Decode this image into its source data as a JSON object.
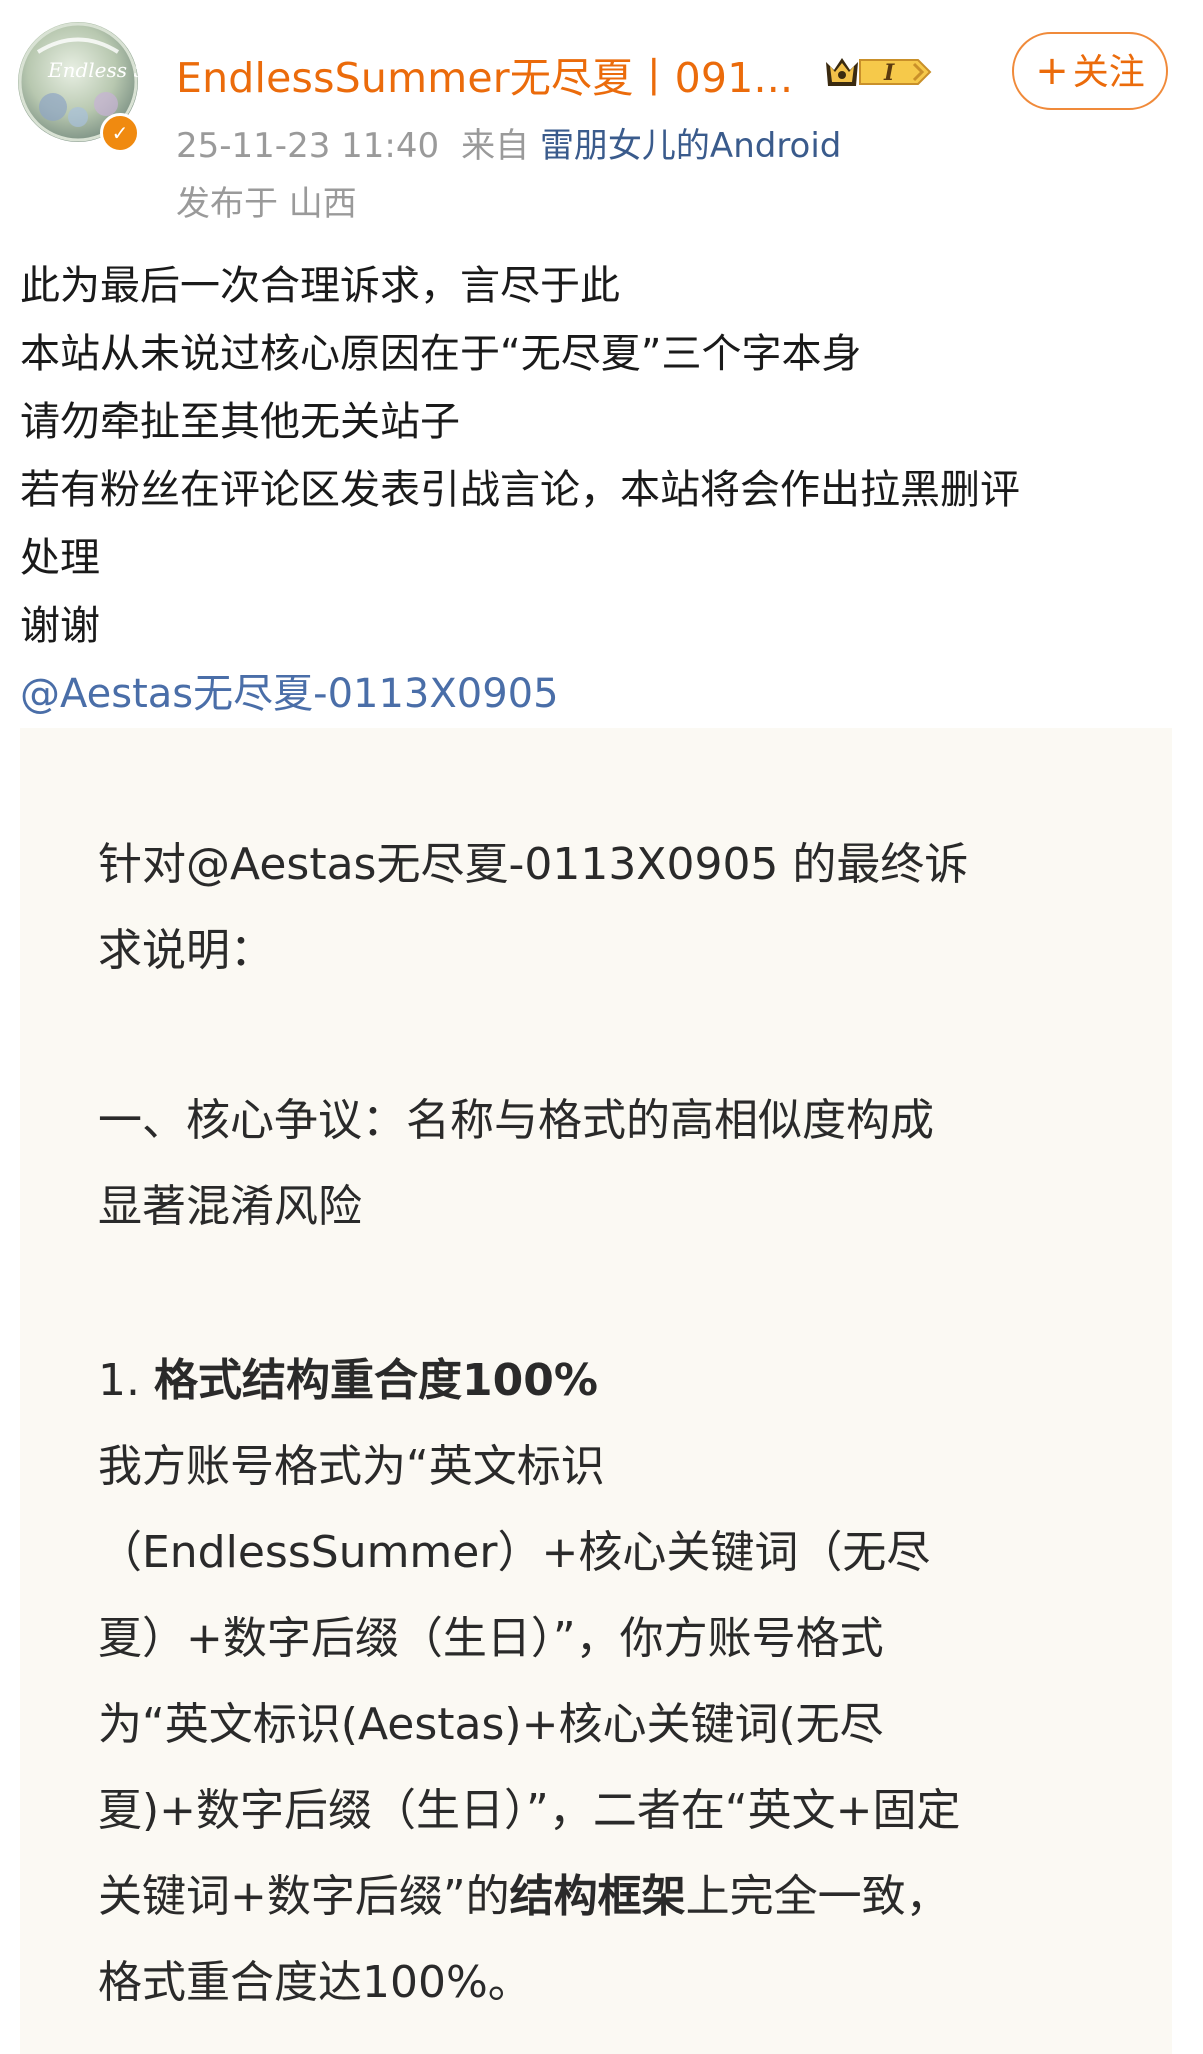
{
  "header": {
    "username": "EndlessSummer无尽夏丨091...",
    "follow_label": "关注",
    "timestamp": "25-11-23 11:40",
    "source_prefix": "来自",
    "source_app": "雷朋女儿的Android",
    "location": "发布于 山西",
    "vip_level": "I",
    "avatar_text": "Endless Summer 无尽夏"
  },
  "post": {
    "lines": [
      "此为最后一次合理诉求，言尽于此",
      "本站从未说过核心原因在于“无尽夏”三个字本身",
      "请勿牵扯至其他无关站子",
      "若有粉丝在评论区发表引战言论，本站将会作出拉黑删评",
      "处理",
      "谢谢"
    ],
    "mention": "@Aestas无尽夏-0113X0905"
  },
  "image": {
    "title_line1": "针对@Aestas无尽夏-0113X0905 的最终诉",
    "title_line2": "求说明：",
    "section1_line1": "一、核心争议：名称与格式的高相似度构成",
    "section1_line2": "显著混淆风险",
    "point1_num": "1. ",
    "point1_title": "格式结构重合度100%",
    "para_line1": "我方账号格式为“英文标识",
    "para_line2": "（EndlessSummer）+核心关键词（无尽",
    "para_line3": "夏）+数字后缀（生日）”，你方账号格式",
    "para_line4": "为“英文标识(Aestas)+核心关键词(无尽",
    "para_line5": "夏)+数字后缀（生日）”，二者在“英文+固定",
    "para_line6_a": "关键词+数字后缀”的",
    "para_line6_b": "结构框架",
    "para_line6_c": "上完全一致，",
    "para_line7": "格式重合度达100%。"
  },
  "colors": {
    "username": "#eb6b0b",
    "link": "#4a6ea8",
    "meta": "#9a9a9a",
    "verified": "#f08a10",
    "card_bg": "#fbf9f3"
  }
}
